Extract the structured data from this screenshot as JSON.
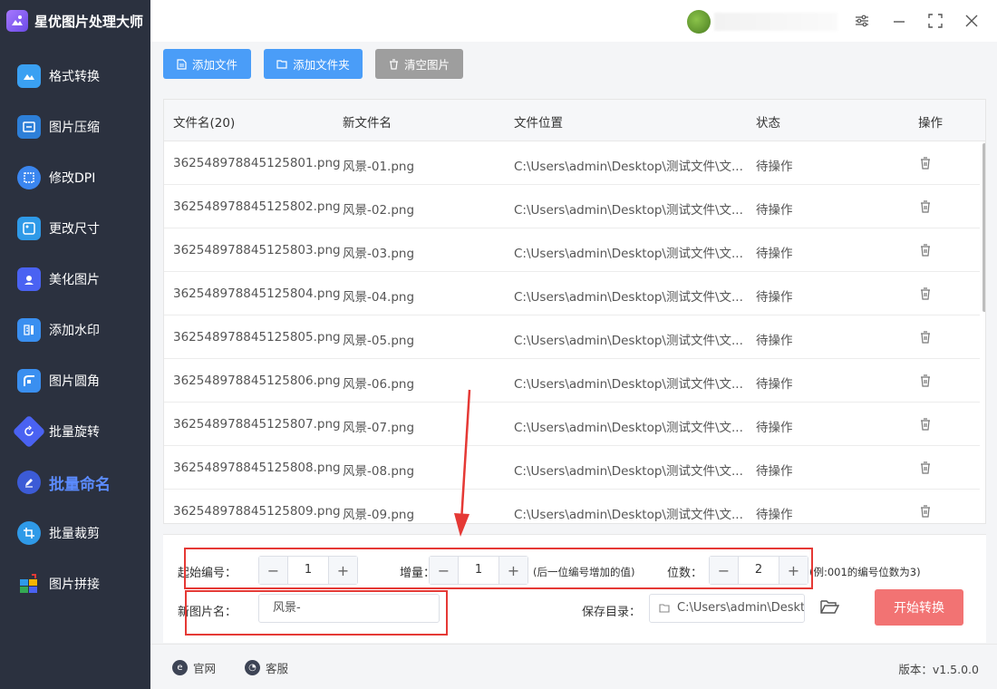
{
  "app": {
    "title": "星优图片处理大师"
  },
  "colors": {
    "sidebar_bg": "#2b313f",
    "accent_blue": "#4a9df8",
    "active_nav": "#5b8bff",
    "start_btn": "#f27373",
    "highlight_red": "#e53935"
  },
  "sidebar": {
    "items": [
      {
        "label": "格式转换",
        "icon": "image-convert-icon"
      },
      {
        "label": "图片压缩",
        "icon": "compress-icon"
      },
      {
        "label": "修改DPI",
        "icon": "dpi-icon"
      },
      {
        "label": "更改尺寸",
        "icon": "resize-icon"
      },
      {
        "label": "美化图片",
        "icon": "beautify-icon"
      },
      {
        "label": "添加水印",
        "icon": "watermark-icon"
      },
      {
        "label": "图片圆角",
        "icon": "rounded-corner-icon"
      },
      {
        "label": "批量旋转",
        "icon": "rotate-icon"
      },
      {
        "label": "批量命名",
        "icon": "rename-icon",
        "active": true
      },
      {
        "label": "批量裁剪",
        "icon": "crop-icon"
      },
      {
        "label": "图片拼接",
        "icon": "stitch-icon"
      }
    ]
  },
  "toolbar": {
    "add_file": "添加文件",
    "add_folder": "添加文件夹",
    "clear": "清空图片"
  },
  "table": {
    "headers": {
      "filename": "文件名(20)",
      "new_name": "新文件名",
      "location": "文件位置",
      "status": "状态",
      "action": "操作"
    },
    "rows": [
      {
        "filename": "362548978845125801.png",
        "new_name": "风景-01.png",
        "location": "C:\\Users\\admin\\Desktop\\测试文件\\文...",
        "status": "待操作"
      },
      {
        "filename": "362548978845125802.png",
        "new_name": "风景-02.png",
        "location": "C:\\Users\\admin\\Desktop\\测试文件\\文...",
        "status": "待操作"
      },
      {
        "filename": "362548978845125803.png",
        "new_name": "风景-03.png",
        "location": "C:\\Users\\admin\\Desktop\\测试文件\\文...",
        "status": "待操作"
      },
      {
        "filename": "362548978845125804.png",
        "new_name": "风景-04.png",
        "location": "C:\\Users\\admin\\Desktop\\测试文件\\文...",
        "status": "待操作"
      },
      {
        "filename": "362548978845125805.png",
        "new_name": "风景-05.png",
        "location": "C:\\Users\\admin\\Desktop\\测试文件\\文...",
        "status": "待操作"
      },
      {
        "filename": "362548978845125806.png",
        "new_name": "风景-06.png",
        "location": "C:\\Users\\admin\\Desktop\\测试文件\\文...",
        "status": "待操作"
      },
      {
        "filename": "362548978845125807.png",
        "new_name": "风景-07.png",
        "location": "C:\\Users\\admin\\Desktop\\测试文件\\文...",
        "status": "待操作"
      },
      {
        "filename": "362548978845125808.png",
        "new_name": "风景-08.png",
        "location": "C:\\Users\\admin\\Desktop\\测试文件\\文...",
        "status": "待操作"
      },
      {
        "filename": "362548978845125809.png",
        "new_name": "风景-09.png",
        "location": "C:\\Users\\admin\\Desktop\\测试文件\\文...",
        "status": "待操作"
      }
    ]
  },
  "settings": {
    "start_label": "起始编号：",
    "start_value": "1",
    "increment_label": "增量：",
    "increment_value": "1",
    "increment_hint": "(后一位编号增加的值)",
    "digits_label": "位数：",
    "digits_value": "2",
    "digits_hint": "(例:001的编号位数为3)",
    "new_name_label": "新图片名：",
    "new_name_value": "风景-",
    "save_dir_label": "保存目录：",
    "save_dir_value": "C:\\Users\\admin\\Deskto",
    "start_button": "开始转换"
  },
  "footer": {
    "website": "官网",
    "support": "客服",
    "version": "版本：v1.5.0.0"
  }
}
